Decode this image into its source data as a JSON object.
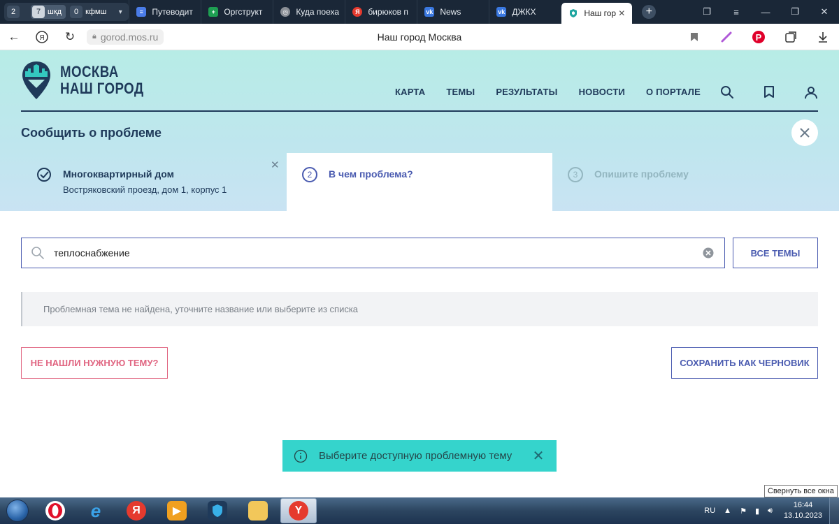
{
  "browser": {
    "tab_groups": [
      {
        "count": "2",
        "label": ""
      },
      {
        "count": "7",
        "label": "шкд"
      },
      {
        "count": "0",
        "label": "кфмш"
      }
    ],
    "tabs": [
      {
        "label": "Путеводит",
        "icon": "docs-icon",
        "color": "#4a7ce8"
      },
      {
        "label": "Оргструкт",
        "icon": "sheets-icon",
        "color": "#1e9e52"
      },
      {
        "label": "Куда поеха",
        "icon": "globe-icon",
        "color": "#8a8f96"
      },
      {
        "label": "бирюков п",
        "icon": "yandex-icon",
        "color": "#e53a2e"
      },
      {
        "label": "News",
        "icon": "vk-icon",
        "color": "#3a78e0"
      },
      {
        "label": "ДЖКХ",
        "icon": "vk-icon",
        "color": "#3a78e0"
      }
    ],
    "active_tab": {
      "label": "Наш гор",
      "icon": "nash-gorod-icon"
    },
    "url": "gorod.mos.ru",
    "page_title": "Наш город Москва"
  },
  "site": {
    "logo_line1": "МОСКВА",
    "logo_line2": "НАШ ГОРОД",
    "nav": [
      "КАРТА",
      "ТЕМЫ",
      "РЕЗУЛЬТАТЫ",
      "НОВОСТИ",
      "О ПОРТАЛЕ"
    ],
    "report_title": "Сообщить о проблеме",
    "steps": [
      {
        "label": "Многоквартирный дом",
        "detail": "Востряковский проезд, дом 1, корпус 1",
        "state": "done"
      },
      {
        "num": "2",
        "label": "В чем проблема?",
        "state": "active"
      },
      {
        "num": "3",
        "label": "Опишите проблему",
        "state": "pending"
      }
    ]
  },
  "form": {
    "search_value": "теплоснабжение",
    "all_themes_label": "ВСЕ ТЕМЫ",
    "notice": "Проблемная тема не найдена, уточните название или выберите из списка",
    "not_found_label": "НЕ НАШЛИ НУЖНУЮ ТЕМУ?",
    "draft_label": "СОХРАНИТЬ КАК ЧЕРНОВИК"
  },
  "toast": {
    "text": "Выберите доступную проблемную тему"
  },
  "tooltip": "Свернуть все окна",
  "taskbar": {
    "lang": "RU",
    "time": "16:44",
    "date": "13.10.2023"
  },
  "colors": {
    "brand_navy": "#1f3a5a",
    "accent_indigo": "#4a5bb0",
    "alert_pink": "#e06480",
    "toast_teal": "#35d4cc"
  }
}
